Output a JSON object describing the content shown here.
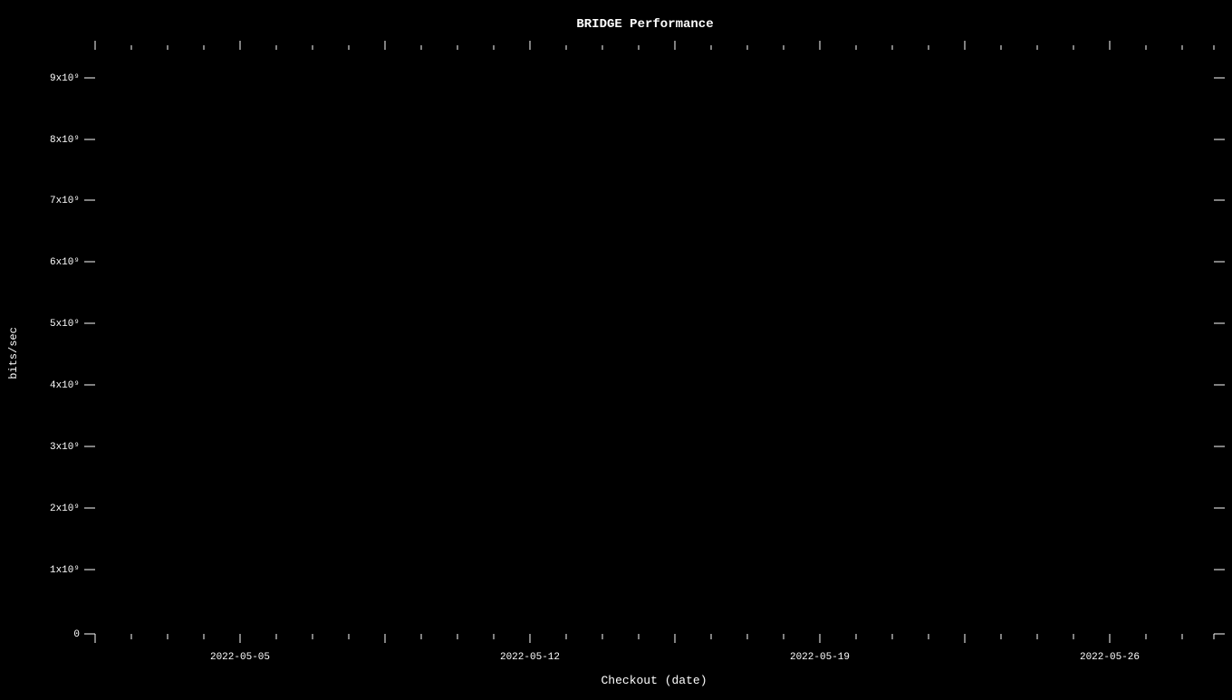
{
  "chart": {
    "title": "BRIDGE Performance",
    "x_axis_label": "Checkout (date)",
    "y_axis_label": "bits/sec",
    "y_ticks": [
      {
        "label": "9x10⁹",
        "value": 9
      },
      {
        "label": "8x10⁹",
        "value": 8
      },
      {
        "label": "7x10⁹",
        "value": 7
      },
      {
        "label": "6x10⁹",
        "value": 6
      },
      {
        "label": "5x10⁹",
        "value": 5
      },
      {
        "label": "4x10⁹",
        "value": 4
      },
      {
        "label": "3x10⁹",
        "value": 3
      },
      {
        "label": "2x10⁹",
        "value": 2
      },
      {
        "label": "1x10⁹",
        "value": 1
      },
      {
        "label": "0",
        "value": 0
      }
    ],
    "x_ticks": [
      {
        "label": "2022-05-05",
        "position": 0.2
      },
      {
        "label": "2022-05-12",
        "position": 0.4
      },
      {
        "label": "2022-05-19",
        "position": 0.6
      },
      {
        "label": "2022-05-26",
        "position": 0.8
      }
    ]
  }
}
